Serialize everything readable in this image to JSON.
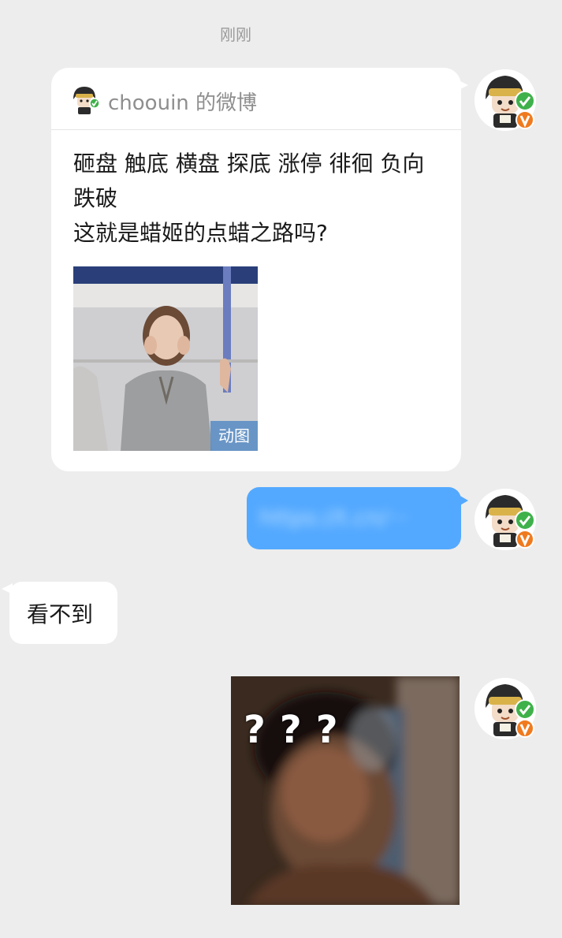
{
  "timestamp": "刚刚",
  "messages": {
    "shared_card": {
      "source": "choouin 的微博",
      "text": "砸盘 触底 横盘 探底 涨停 徘徊 负向\n跌破\n这就是蜡姬的点蜡之路吗?",
      "image_badge": "动图"
    },
    "blurred_link": "https://t.cn/···",
    "reply_text": "看不到",
    "meme_overlay": "???"
  },
  "icons": {
    "avatar": "avatar-icon",
    "verified_check": "verified-check-icon",
    "vip_badge": "vip-badge-icon"
  },
  "colors": {
    "background": "#ededed",
    "sent_bubble": "#53a9ff",
    "received_bubble": "#ffffff",
    "verified_green": "#3fb14a",
    "vip_orange": "#f07a1e"
  }
}
